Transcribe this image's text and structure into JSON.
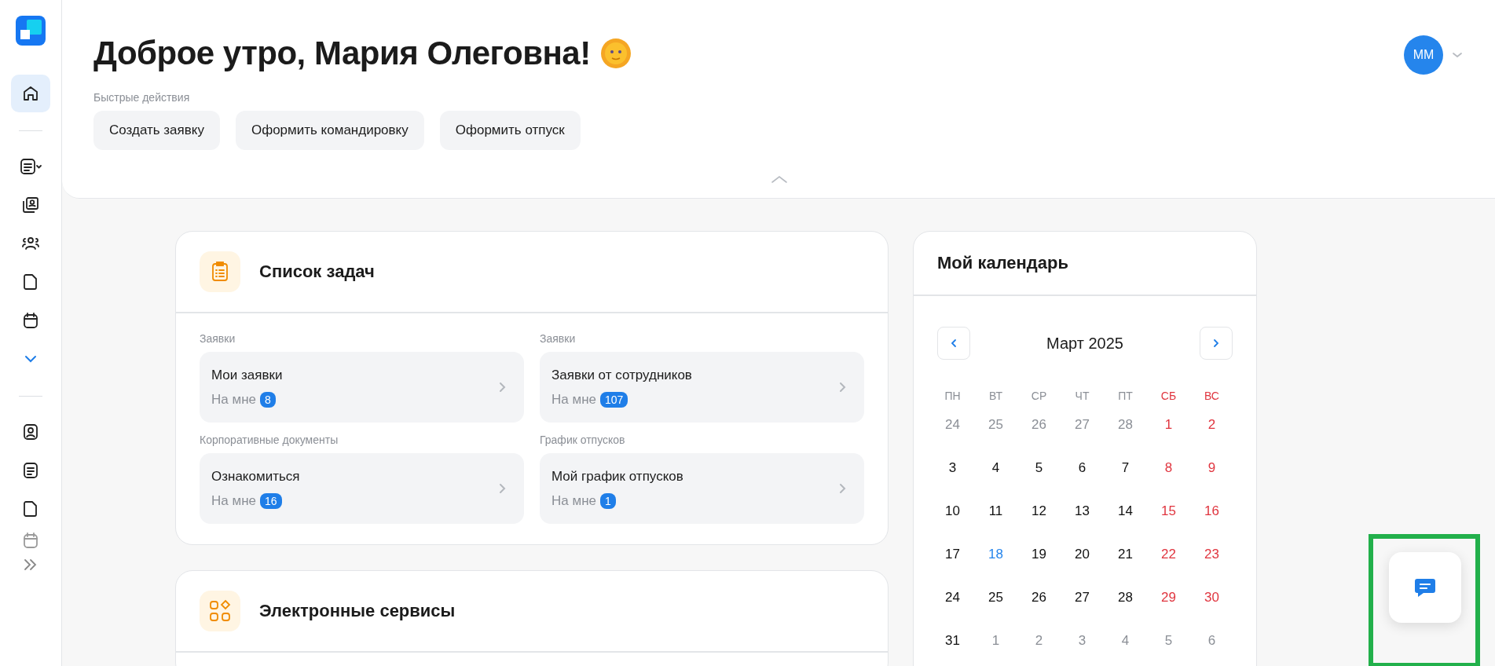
{
  "sidebar": {
    "groups": [
      {
        "items": [
          {
            "kind": "home",
            "selected": true
          }
        ]
      },
      {
        "items": [
          {
            "kind": "list-caret",
            "selected": false
          },
          {
            "kind": "contacts",
            "selected": false
          },
          {
            "kind": "people",
            "selected": false
          },
          {
            "kind": "file",
            "selected": false
          },
          {
            "kind": "calendar",
            "selected": false
          },
          {
            "kind": "more",
            "selected": false
          }
        ]
      },
      {
        "items": [
          {
            "kind": "profile",
            "selected": false
          },
          {
            "kind": "list",
            "selected": false
          },
          {
            "kind": "file",
            "selected": false
          },
          {
            "kind": "calendar-faded",
            "selected": false
          }
        ]
      }
    ]
  },
  "header": {
    "greeting": "Доброе утро, Мария Олеговна!",
    "quick_actions_label": "Быстрые действия",
    "quick_actions": [
      "Создать заявку",
      "Оформить командировку",
      "Оформить отпуск"
    ],
    "avatar_initials": "ММ"
  },
  "tasks": {
    "title": "Список задач",
    "groups": [
      {
        "label": "Заявки",
        "title": "Мои заявки",
        "sub": "На мне",
        "count": "8"
      },
      {
        "label": "Заявки",
        "title": "Заявки от сотрудников",
        "sub": "На мне",
        "count": "107"
      },
      {
        "label": "Корпоративные документы",
        "title": "Ознакомиться",
        "sub": "На мне",
        "count": "16"
      },
      {
        "label": "График отпусков",
        "title": "Мой график отпусков",
        "sub": "На мне",
        "count": "1"
      }
    ]
  },
  "services": {
    "title": "Электронные сервисы"
  },
  "calendar": {
    "title": "Мой календарь",
    "month": "Март 2025",
    "weekdays": [
      {
        "label": "ПН",
        "weekend": false
      },
      {
        "label": "ВТ",
        "weekend": false
      },
      {
        "label": "СР",
        "weekend": false
      },
      {
        "label": "ЧТ",
        "weekend": false
      },
      {
        "label": "ПТ",
        "weekend": false
      },
      {
        "label": "СБ",
        "weekend": true
      },
      {
        "label": "ВС",
        "weekend": true
      }
    ],
    "days": [
      {
        "day": "24",
        "kind": "outside"
      },
      {
        "day": "25",
        "kind": "outside"
      },
      {
        "day": "26",
        "kind": "outside"
      },
      {
        "day": "27",
        "kind": "outside"
      },
      {
        "day": "28",
        "kind": "outside"
      },
      {
        "day": "1",
        "kind": "weekend"
      },
      {
        "day": "2",
        "kind": "weekend"
      },
      {
        "day": "3",
        "kind": "regular"
      },
      {
        "day": "4",
        "kind": "regular"
      },
      {
        "day": "5",
        "kind": "regular"
      },
      {
        "day": "6",
        "kind": "regular"
      },
      {
        "day": "7",
        "kind": "regular"
      },
      {
        "day": "8",
        "kind": "weekend"
      },
      {
        "day": "9",
        "kind": "weekend"
      },
      {
        "day": "10",
        "kind": "regular"
      },
      {
        "day": "11",
        "kind": "regular"
      },
      {
        "day": "12",
        "kind": "regular"
      },
      {
        "day": "13",
        "kind": "regular"
      },
      {
        "day": "14",
        "kind": "regular"
      },
      {
        "day": "15",
        "kind": "weekend"
      },
      {
        "day": "16",
        "kind": "weekend"
      },
      {
        "day": "17",
        "kind": "regular"
      },
      {
        "day": "18",
        "kind": "today"
      },
      {
        "day": "19",
        "kind": "regular"
      },
      {
        "day": "20",
        "kind": "regular"
      },
      {
        "day": "21",
        "kind": "regular"
      },
      {
        "day": "22",
        "kind": "weekend"
      },
      {
        "day": "23",
        "kind": "weekend"
      },
      {
        "day": "24",
        "kind": "regular"
      },
      {
        "day": "25",
        "kind": "regular"
      },
      {
        "day": "26",
        "kind": "regular"
      },
      {
        "day": "27",
        "kind": "regular"
      },
      {
        "day": "28",
        "kind": "regular"
      },
      {
        "day": "29",
        "kind": "weekend"
      },
      {
        "day": "30",
        "kind": "weekend"
      },
      {
        "day": "31",
        "kind": "regular"
      },
      {
        "day": "1",
        "kind": "outside"
      },
      {
        "day": "2",
        "kind": "outside"
      },
      {
        "day": "3",
        "kind": "outside"
      },
      {
        "day": "4",
        "kind": "outside"
      },
      {
        "day": "5",
        "kind": "outside"
      },
      {
        "day": "6",
        "kind": "outside"
      }
    ]
  }
}
